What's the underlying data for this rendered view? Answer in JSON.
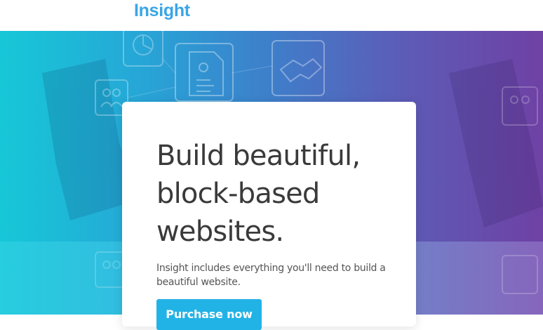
{
  "header": {
    "brand": "Insight"
  },
  "hero": {
    "headline": "Build beautiful, block-based websites.",
    "subtext": "Insight includes everything you'll need to build a beautiful website.",
    "cta_label": "Purchase now"
  },
  "colors": {
    "brand": "#3aa6e6",
    "cta": "#22b3e6",
    "hero_left": "#1ec7d6",
    "hero_right": "#6f43a6",
    "headline_text": "#3a3a3a"
  },
  "icons": [
    "document-icon",
    "handshake-icon",
    "chart-icon",
    "people-icon"
  ]
}
